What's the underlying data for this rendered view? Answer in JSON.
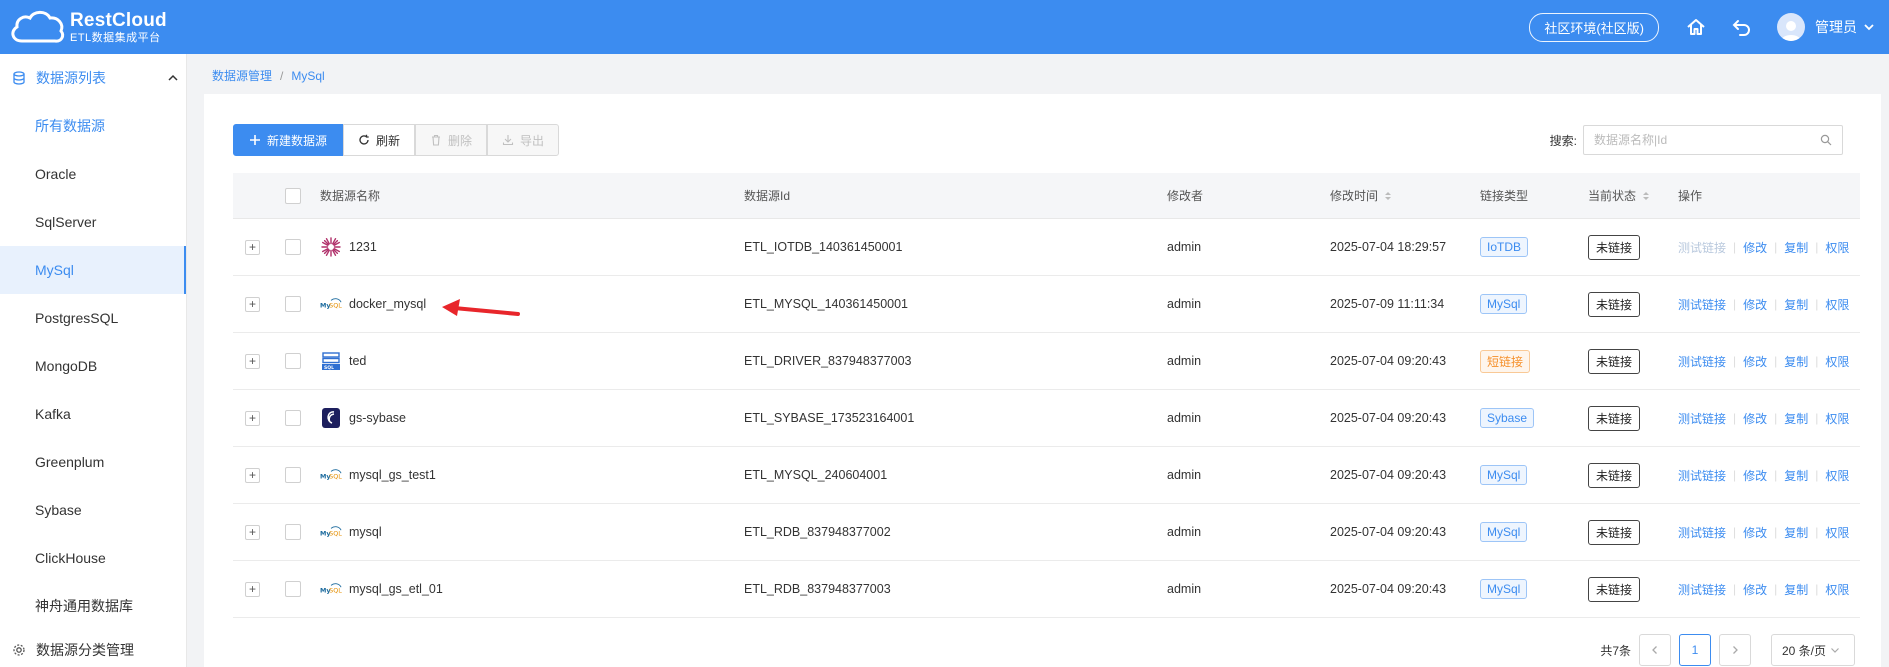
{
  "header": {
    "logo_title": "RestCloud",
    "logo_subtitle": "ETL数据集成平台",
    "env_label": "社区环境(社区版)",
    "user_name": "管理员",
    "bar_color": "#3c8cf0"
  },
  "sidebar": {
    "section_title": "数据源列表",
    "items": [
      {
        "label": "所有数据源"
      },
      {
        "label": "Oracle"
      },
      {
        "label": "SqlServer"
      },
      {
        "label": "MySql"
      },
      {
        "label": "PostgresSQL"
      },
      {
        "label": "MongoDB"
      },
      {
        "label": "Kafka"
      },
      {
        "label": "Greenplum"
      },
      {
        "label": "Sybase"
      },
      {
        "label": "ClickHouse"
      },
      {
        "label": "神舟通用数据库"
      }
    ],
    "active_item": "MySql",
    "footer_label": "数据源分类管理"
  },
  "breadcrumb": {
    "root": "数据源管理",
    "separator": "/",
    "current": "MySql"
  },
  "toolbar": {
    "new_label": "新建数据源",
    "refresh_label": "刷新",
    "delete_label": "删除",
    "export_label": "导出",
    "search_label": "搜索:",
    "search_placeholder": "数据源名称|Id"
  },
  "table": {
    "headers": {
      "name": "数据源名称",
      "id": "数据源Id",
      "modifier": "修改者",
      "time": "修改时间",
      "type": "链接类型",
      "status": "当前状态",
      "ops": "操作"
    },
    "ops_labels": {
      "test": "测试链接",
      "edit": "修改",
      "copy": "复制",
      "perm": "权限"
    },
    "rows": [
      {
        "name": "1231",
        "icon": "iotdb-icon",
        "id": "ETL_IOTDB_140361450001",
        "modifier": "admin",
        "time": "2025-07-04 18:29:57",
        "type": "IoTDB",
        "type_color": "blue",
        "status": "未链接",
        "test_enabled": false
      },
      {
        "name": "docker_mysql",
        "icon": "mysql-icon",
        "id": "ETL_MYSQL_140361450001",
        "modifier": "admin",
        "time": "2025-07-09 11:11:34",
        "type": "MySql",
        "type_color": "blue",
        "status": "未链接",
        "test_enabled": true
      },
      {
        "name": "ted",
        "icon": "sql-driver-icon",
        "id": "ETL_DRIVER_837948377003",
        "modifier": "admin",
        "time": "2025-07-04 09:20:43",
        "type": "短链接",
        "type_color": "orange",
        "status": "未链接",
        "test_enabled": true
      },
      {
        "name": "gs-sybase",
        "icon": "sybase-icon",
        "id": "ETL_SYBASE_173523164001",
        "modifier": "admin",
        "time": "2025-07-04 09:20:43",
        "type": "Sybase",
        "type_color": "blue",
        "status": "未链接",
        "test_enabled": true
      },
      {
        "name": "mysql_gs_test1",
        "icon": "mysql-icon",
        "id": "ETL_MYSQL_240604001",
        "modifier": "admin",
        "time": "2025-07-04 09:20:43",
        "type": "MySql",
        "type_color": "blue",
        "status": "未链接",
        "test_enabled": true
      },
      {
        "name": "mysql",
        "icon": "mysql-icon",
        "id": "ETL_RDB_837948377002",
        "modifier": "admin",
        "time": "2025-07-04 09:20:43",
        "type": "MySql",
        "type_color": "blue",
        "status": "未链接",
        "test_enabled": true
      },
      {
        "name": "mysql_gs_etl_01",
        "icon": "mysql-icon",
        "id": "ETL_RDB_837948377003",
        "modifier": "admin",
        "time": "2025-07-04 09:20:43",
        "type": "MySql",
        "type_color": "blue",
        "status": "未链接",
        "test_enabled": true
      }
    ]
  },
  "pagination": {
    "total": "共7条",
    "current_page": "1",
    "page_size": "20 条/页"
  }
}
